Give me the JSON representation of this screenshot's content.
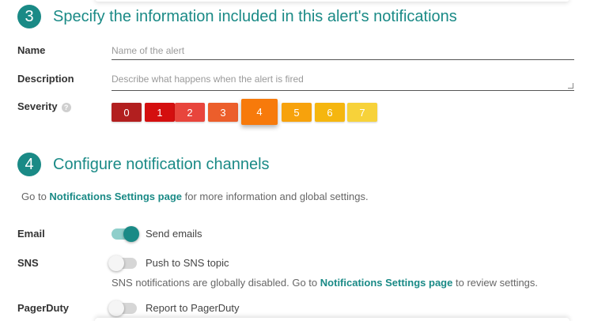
{
  "step3": {
    "number": "3",
    "title": "Specify the information included in this alert's notifications"
  },
  "name": {
    "label": "Name",
    "placeholder": "Name of the alert"
  },
  "description": {
    "label": "Description",
    "placeholder": "Describe what happens when the alert is fired"
  },
  "severity": {
    "label": "Severity",
    "help_icon": "?",
    "selected": "4",
    "levels": [
      {
        "label": "0",
        "color": "#b21f1f"
      },
      {
        "label": "1",
        "color": "#d40f0f"
      },
      {
        "label": "2",
        "color": "#e8453c"
      },
      {
        "label": "3",
        "color": "#ec5e2b"
      },
      {
        "label": "4",
        "color": "#f77a0b"
      },
      {
        "label": "5",
        "color": "#f7a20c"
      },
      {
        "label": "6",
        "color": "#f5b60f"
      },
      {
        "label": "7",
        "color": "#f7d23a"
      }
    ]
  },
  "step4": {
    "number": "4",
    "title": "Configure notification channels"
  },
  "channels_info": {
    "prefix": "Go to",
    "link": "Notifications Settings page",
    "suffix": "for more information and global settings."
  },
  "email": {
    "label": "Email",
    "toggle_label": "Send emails",
    "enabled": true
  },
  "sns": {
    "label": "SNS",
    "toggle_label": "Push to SNS topic",
    "enabled": false,
    "note_prefix": "SNS notifications are globally disabled. Go to",
    "note_link": "Notifications Settings page",
    "note_suffix": "to review settings."
  },
  "pagerduty": {
    "label": "PagerDuty",
    "toggle_label": "Report to PagerDuty",
    "enabled": false
  }
}
